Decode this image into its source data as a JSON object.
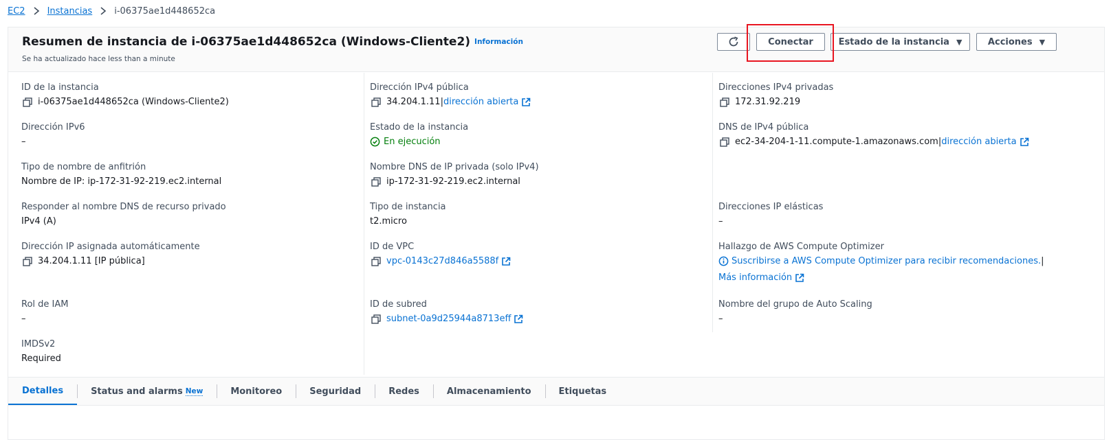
{
  "breadcrumb": {
    "items": [
      "EC2",
      "Instancias"
    ],
    "current": "i-06375ae1d448652ca"
  },
  "header": {
    "title": "Resumen de instancia de i-06375ae1d448652ca (Windows-Cliente2)",
    "info_link": "Información",
    "updated": "Se ha actualizado hace less than a minute",
    "refresh_icon": "refresh-icon",
    "connect_label": "Conectar",
    "state_label": "Estado de la instancia",
    "actions_label": "Acciones"
  },
  "details": {
    "instance_id": {
      "label": "ID de la instancia",
      "value": "i-06375ae1d448652ca (Windows-Cliente2)"
    },
    "public_ipv4": {
      "label": "Dirección IPv4 pública",
      "value": "34.204.1.11",
      "sep": " |",
      "link": "dirección abierta"
    },
    "private_ipv4": {
      "label": "Direcciones IPv4 privadas",
      "value": "172.31.92.219"
    },
    "ipv6": {
      "label": "Dirección IPv6",
      "value": "–"
    },
    "state": {
      "label": "Estado de la instancia",
      "value": "En ejecución",
      "color": "#037f0c"
    },
    "public_dns": {
      "label": "DNS de IPv4 pública",
      "value": "ec2-34-204-1-11.compute-1.amazonaws.com",
      "sep": " |",
      "link": "dirección abierta"
    },
    "hostname_type": {
      "label": "Tipo de nombre de anfitrión",
      "value": "Nombre de IP: ip-172-31-92-219.ec2.internal"
    },
    "private_dns": {
      "label": "Nombre DNS de IP privada (solo IPv4)",
      "value": "ip-172-31-92-219.ec2.internal"
    },
    "resource_dns": {
      "label": "Responder al nombre DNS de recurso privado",
      "value": "IPv4 (A)"
    },
    "instance_type": {
      "label": "Tipo de instancia",
      "value": "t2.micro"
    },
    "elastic_ip": {
      "label": "Direcciones IP elásticas",
      "value": "–"
    },
    "auto_ip": {
      "label": "Dirección IP asignada automáticamente",
      "value": "34.204.1.11 [IP pública]"
    },
    "vpc": {
      "label": "ID de VPC",
      "value": "vpc-0143c27d846a5588f"
    },
    "optimizer": {
      "label": "Hallazgo de AWS Compute Optimizer",
      "link": "Suscribirse a AWS Compute Optimizer para recibir recomendaciones.",
      "sep": " |",
      "more": "Más información"
    },
    "iam_role": {
      "label": "Rol de IAM",
      "value": "–"
    },
    "subnet": {
      "label": "ID de subred",
      "value": "subnet-0a9d25944a8713eff"
    },
    "asg": {
      "label": "Nombre del grupo de Auto Scaling",
      "value": "–"
    },
    "imds": {
      "label": "IMDSv2",
      "value": "Required"
    }
  },
  "tabs": [
    {
      "label": "Detalles",
      "active": true
    },
    {
      "label": "Status and alarms",
      "badge": "New"
    },
    {
      "label": "Monitoreo"
    },
    {
      "label": "Seguridad"
    },
    {
      "label": "Redes"
    },
    {
      "label": "Almacenamiento"
    },
    {
      "label": "Etiquetas"
    }
  ],
  "colors": {
    "link": "#0972d3",
    "highlight": "#e8141f",
    "success": "#037f0c"
  }
}
